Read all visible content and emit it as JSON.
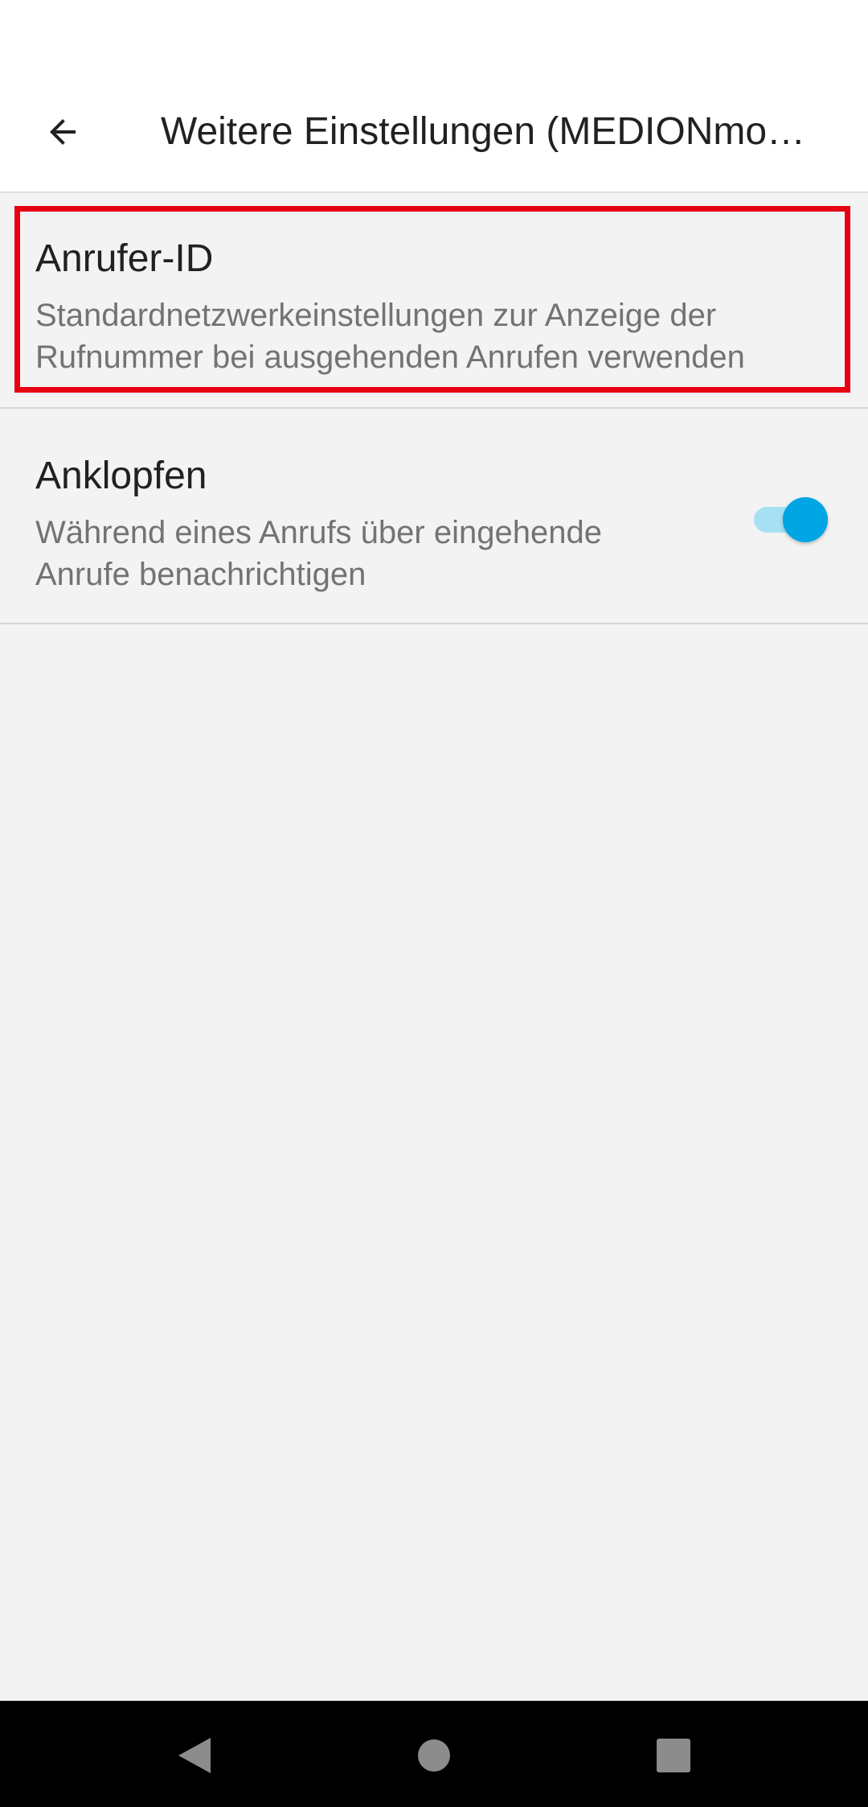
{
  "app_bar": {
    "title": "Weitere Einstellungen (MEDIONmo…",
    "back_icon": "arrow-back-icon"
  },
  "preferences": [
    {
      "title": "Anrufer-ID",
      "summary": "Standardnetzwerkeinstellungen zur Anzeige der Rufnummer bei ausgehenden Anrufen verwenden",
      "highlighted": true
    },
    {
      "title": "Anklopfen",
      "summary": "Während eines Anrufs über eingehende Anrufe benachrichtigen",
      "toggle_on": true
    }
  ],
  "nav_bar": {
    "back_icon": "triangle-back-icon",
    "home_icon": "circle-home-icon",
    "recents_icon": "square-recents-icon"
  },
  "colors": {
    "accent": "#00a6e4",
    "accent_track": "#a8e0f3",
    "highlight": "#e60012",
    "background": "#f3f3f3"
  }
}
